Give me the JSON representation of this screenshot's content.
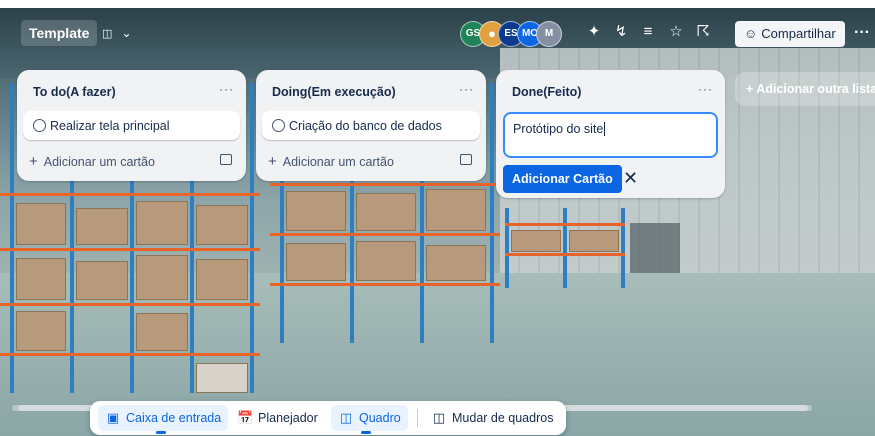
{
  "board": {
    "title": "Template",
    "view_icon": "board-view-icon",
    "colors": {
      "accent": "#0c66e4",
      "composer_border": "#388bff"
    }
  },
  "header": {
    "avatars": [
      {
        "initials": "GS",
        "color": "#1f845a"
      },
      {
        "initials": "",
        "color": "#e2a03f",
        "icon": "user-photo-icon"
      },
      {
        "initials": "ES",
        "color": "#0c3a8f"
      },
      {
        "initials": "MO",
        "color": "#0c66e4"
      },
      {
        "initials": "M",
        "color": "#8590a2"
      }
    ],
    "share_label": "Compartilhar",
    "more_label": "···"
  },
  "lists": [
    {
      "title": "To do(A fazer)",
      "menu": "···",
      "cards": [
        "Realizar tela principal"
      ],
      "add_card_label": "Adicionar um cartão"
    },
    {
      "title": "Doing(Em execução)",
      "menu": "···",
      "cards": [
        "Criação do banco de dados"
      ],
      "add_card_label": "Adicionar um cartão"
    },
    {
      "title": "Done(Feito)",
      "menu": "···",
      "composer_value": "Protótipo do site",
      "submit_label": "Adicionar Cartão",
      "cancel_label": "✕"
    }
  ],
  "add_list_label": "+  Adicionar outra lista",
  "bottom_nav": [
    {
      "label": "Caixa de entrada",
      "icon": "inbox-icon",
      "active": true
    },
    {
      "label": "Planejador",
      "icon": "calendar-icon",
      "active": false
    },
    {
      "label": "Quadro",
      "icon": "board-icon",
      "active": true
    },
    {
      "label": "Mudar de quadros",
      "icon": "switch-boards-icon",
      "active": false
    }
  ]
}
